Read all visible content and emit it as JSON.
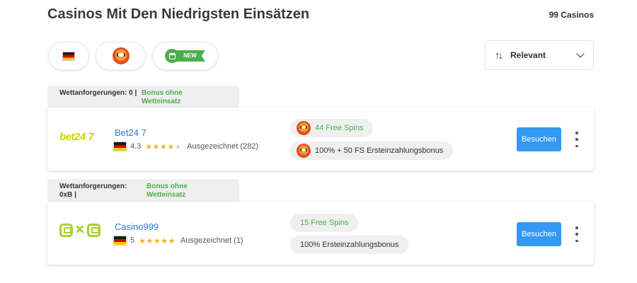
{
  "page": {
    "title": "Casinos Mit Den Niedrigsten Einsätzen",
    "count": "99 Casinos"
  },
  "filters": {
    "flag_icon": "german-flag-icon",
    "mascot_icon": "orange-mascot-icon",
    "new_label": "NEW"
  },
  "sort": {
    "icon": "sort-arrows-icon",
    "label": "Relevant"
  },
  "colors": {
    "accent_blue": "#3399f3",
    "link_blue": "#2b7bd6",
    "green": "#4cae4f",
    "star": "#f3b21a"
  },
  "casinos": [
    {
      "tab_requirement": "Wettanforgerungen: 0 |",
      "tab_bonus": "Bonus ohne Wetteinsatz",
      "logo_text": "bet24 7",
      "name": "Bet24 7",
      "score": "4.3",
      "stars": "★★★★",
      "stars_dim": "★",
      "rating_label": "Ausgezeichnet (282)",
      "rating_fraction": 0.86,
      "pill_1": "44 Free Spins",
      "pill_2": "100% + 50 FS Ersteinzahlungsbonus",
      "visit_label": "Besuchen"
    },
    {
      "tab_requirement": "Wettanforgerungen: 0xB |",
      "tab_bonus": "Bonus ohne Wetteinsatz",
      "name": "Casino999",
      "score": "5",
      "stars": "★★★★★",
      "rating_label": "Ausgezeichnet (1)",
      "rating_fraction": 1.0,
      "pill_1": "15 Free Spins",
      "pill_2": "100% Ersteinzahlungsbonus",
      "visit_label": "Besuchen"
    }
  ]
}
